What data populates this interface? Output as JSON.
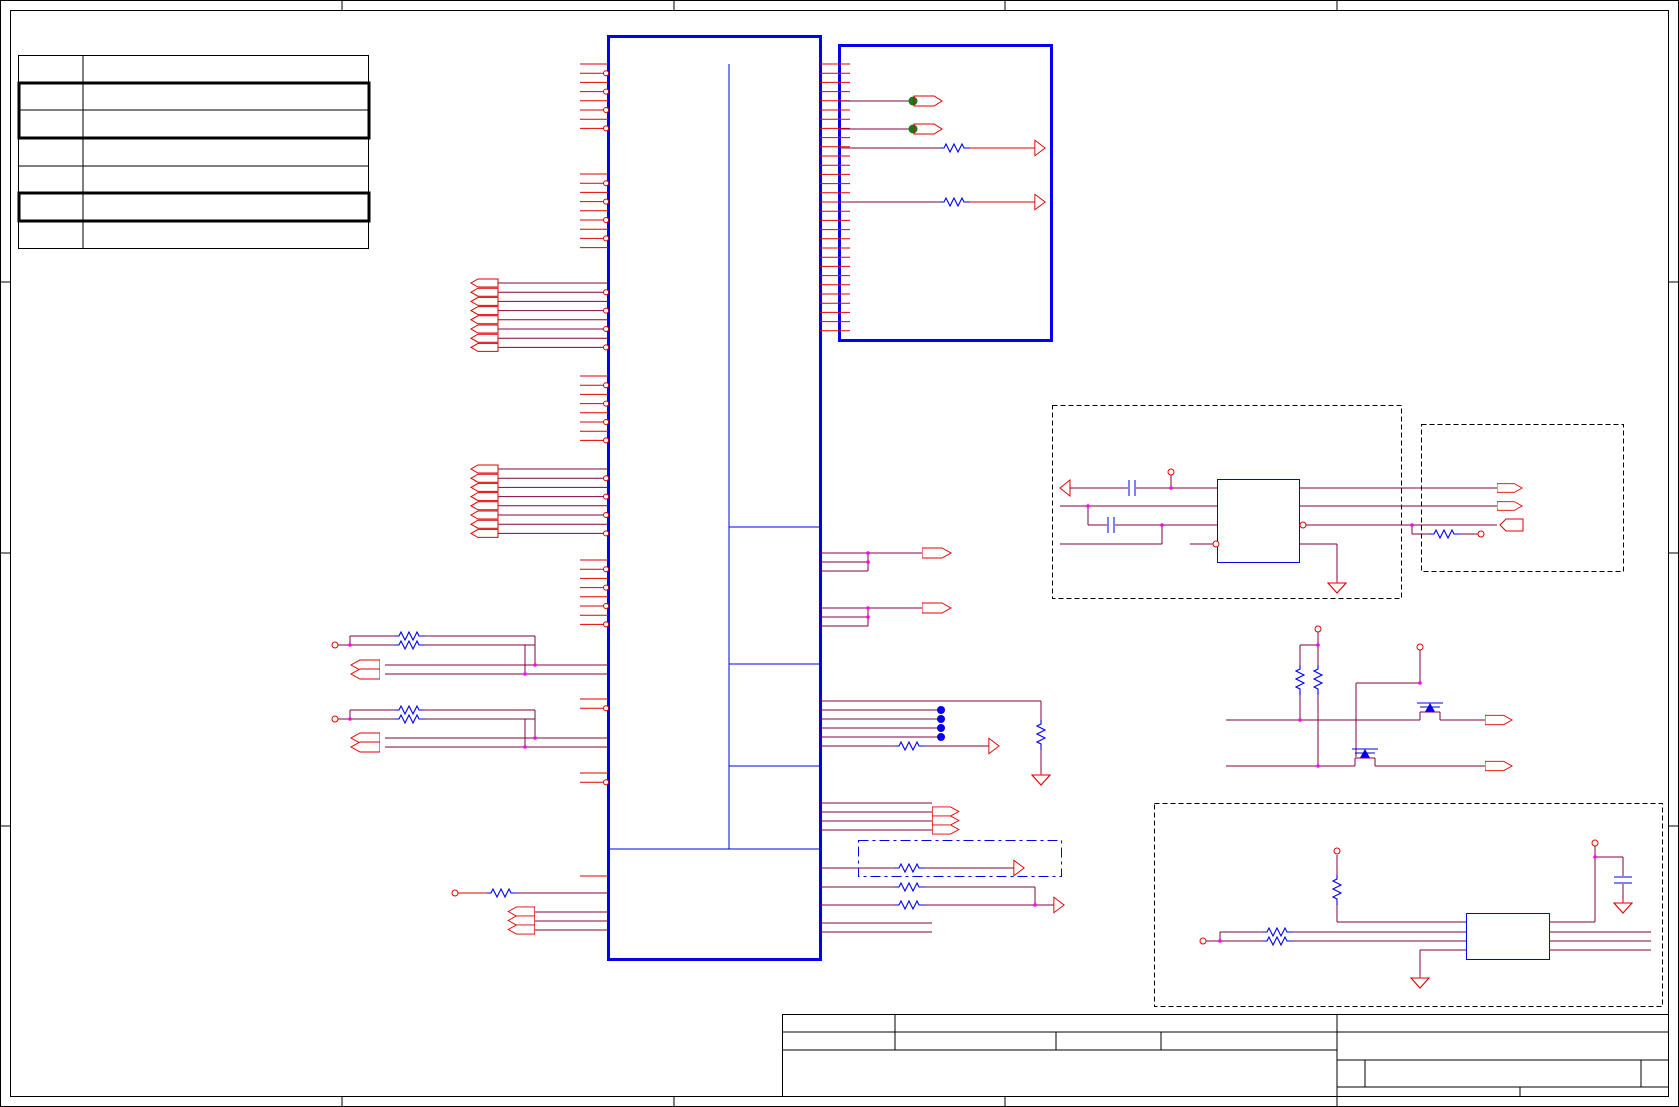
{
  "colors": {
    "wire": "#e00000",
    "net": "#800040",
    "component": "#0000ee",
    "junction": "#ff00ff",
    "led": "#1a7a1a",
    "border": "#000000"
  },
  "revision_table": {
    "rows": 6,
    "highlighted_rows": [
      1,
      2,
      4
    ]
  },
  "title_block": {
    "present": true
  },
  "icons": {
    "resistor": "resistor-icon",
    "capacitor": "capacitor-icon",
    "ground": "ground-icon",
    "port": "port-icon",
    "power": "power-arrow-icon",
    "mosfet": "mosfet-icon",
    "led": "led-icon",
    "test_point": "test-point-icon"
  }
}
